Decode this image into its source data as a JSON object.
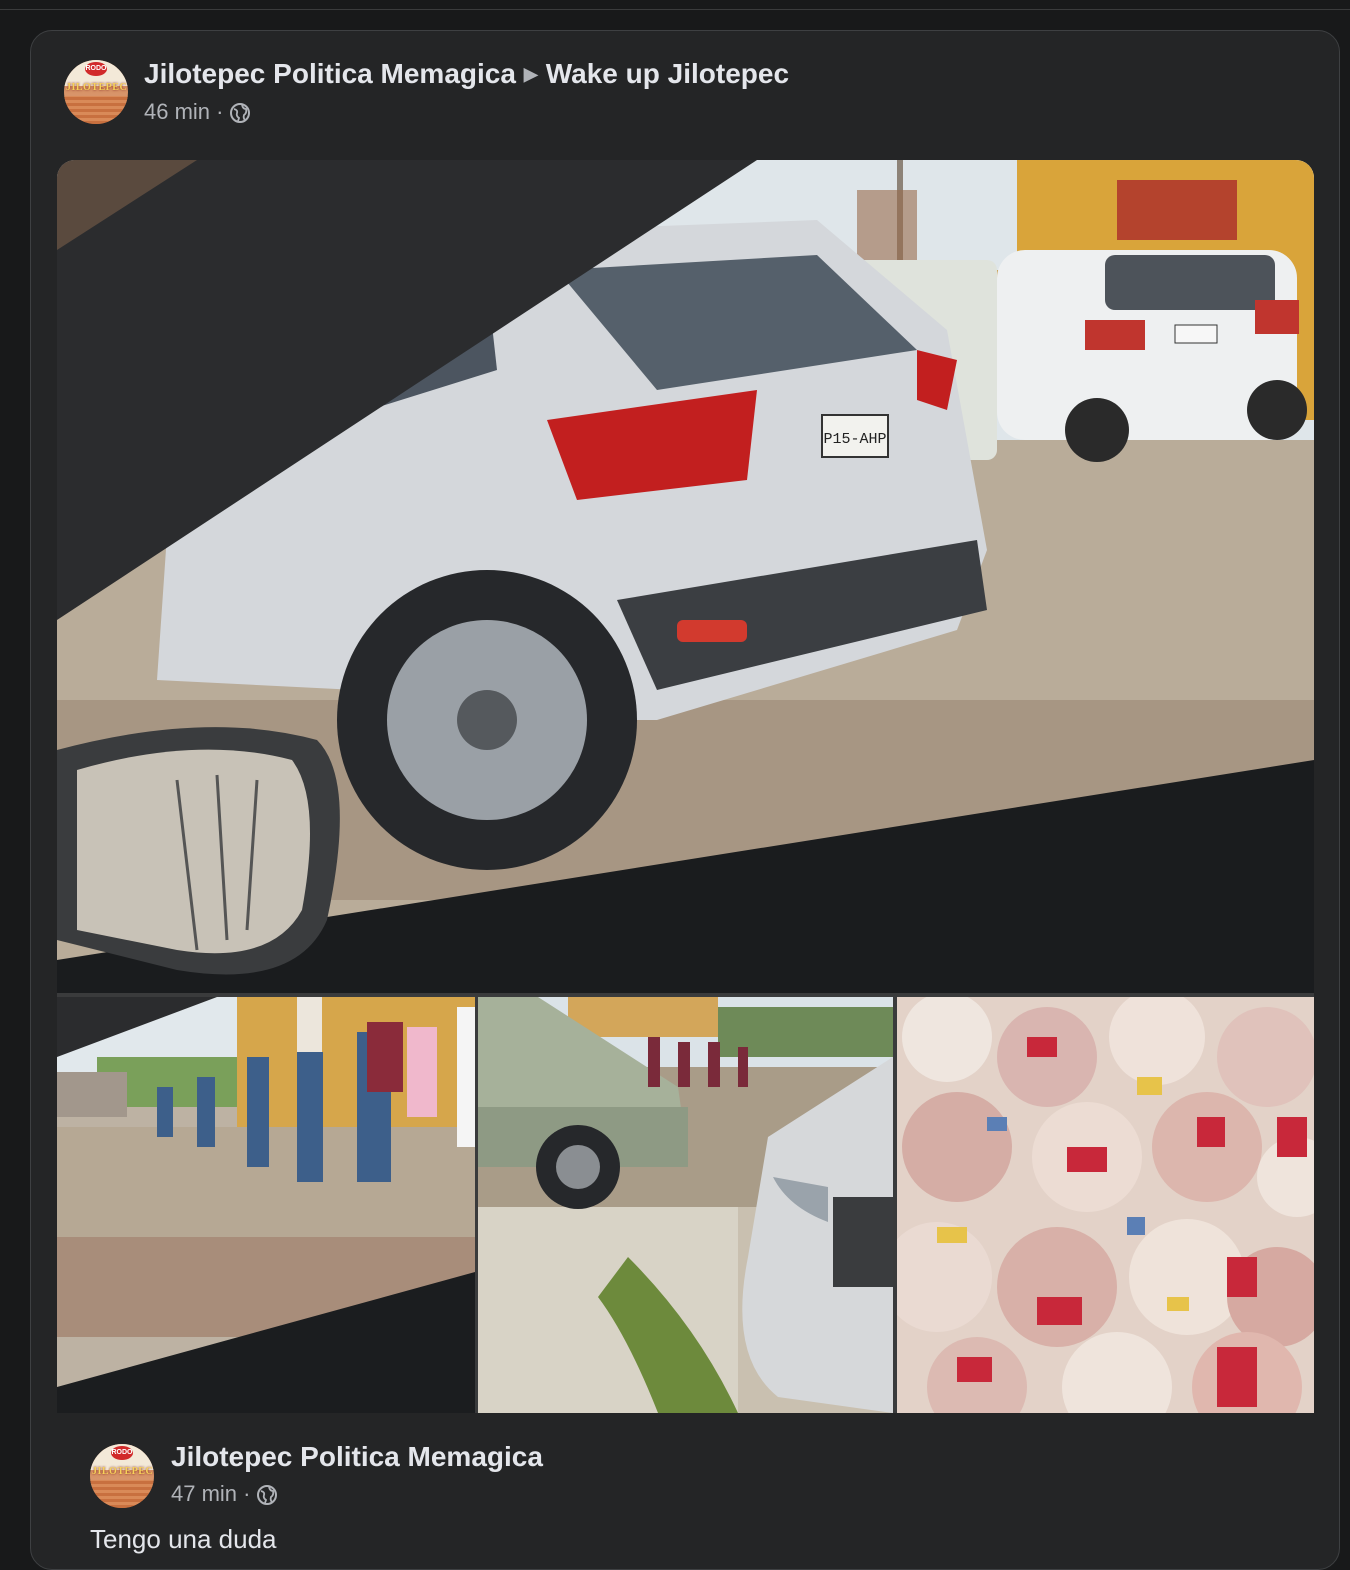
{
  "post": {
    "author": "Jilotepec Politica Memagica",
    "target_group": "Wake up Jilotepec",
    "time": "46 min",
    "separator": "·",
    "audience_icon": "globe-icon",
    "avatar": {
      "badge_text": "RODO",
      "sign_text": "JILOTEPEC"
    }
  },
  "photos": [
    {
      "plate_text": "P15-AHP"
    },
    {},
    {},
    {}
  ],
  "shared_post": {
    "author": "Jilotepec Politica Memagica",
    "time": "47 min",
    "separator": "·",
    "audience_icon": "globe-icon",
    "text": "Tengo una duda"
  }
}
